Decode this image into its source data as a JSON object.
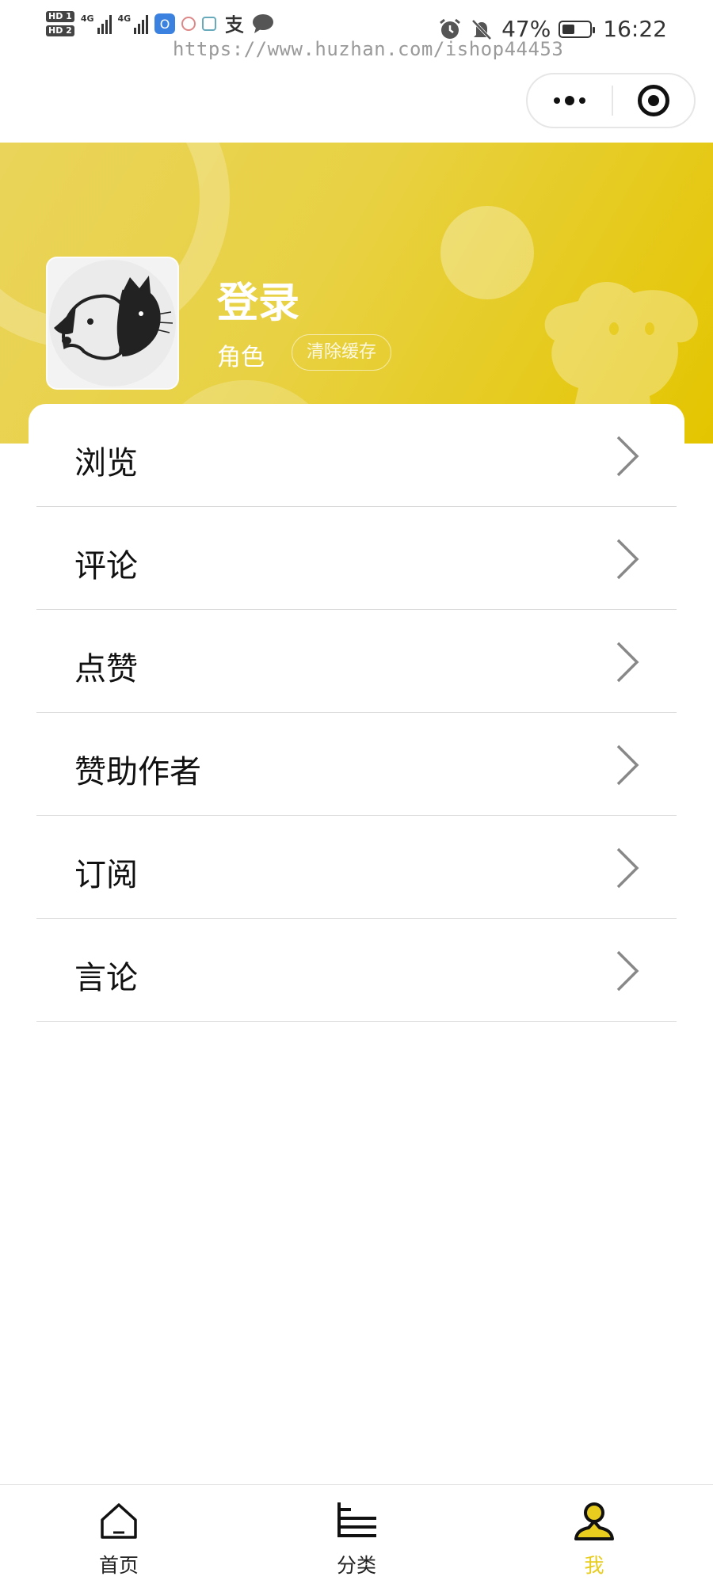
{
  "status_bar": {
    "sim1": "HD 1",
    "sim2": "HD 2",
    "network1": "4G",
    "network2": "4G",
    "battery_percent": "47%",
    "battery_level": 0.47,
    "time": "16:22",
    "icons": [
      "alarm-icon",
      "mute-bell-icon",
      "battery-icon"
    ],
    "app_icons": [
      "notification-app-icon",
      "wechat-message-icon",
      "alipay-icon"
    ]
  },
  "watermark": "https://www.huzhan.com/ishop44453",
  "capsule": {
    "more_icon": "more-dots-icon",
    "close_icon": "target-close-icon"
  },
  "profile": {
    "title": "登录",
    "role": "角色",
    "clear_cache": "清除缓存",
    "accent": "#e8cc1e"
  },
  "menu": [
    {
      "label": "浏览"
    },
    {
      "label": "评论"
    },
    {
      "label": "点赞"
    },
    {
      "label": "赞助作者"
    },
    {
      "label": "订阅"
    },
    {
      "label": "言论"
    }
  ],
  "tabbar": {
    "items": [
      {
        "label": "首页",
        "icon": "home-icon",
        "active": false
      },
      {
        "label": "分类",
        "icon": "category-icon",
        "active": false
      },
      {
        "label": "我",
        "icon": "user-icon",
        "active": true
      }
    ],
    "active_color": "#e8cc1e"
  }
}
